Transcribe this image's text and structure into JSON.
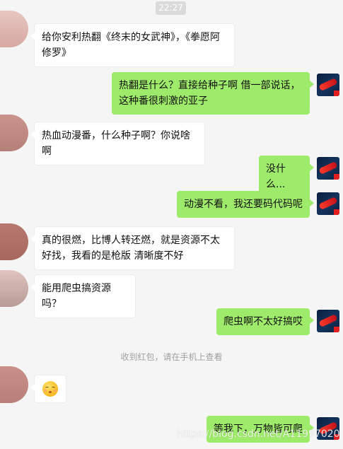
{
  "header": {
    "time": "22:27"
  },
  "colors": {
    "background": "#f5f5f5",
    "bubble_incoming": "#ffffff",
    "bubble_outgoing": "#9eea6a",
    "avatar_left_a": "#e8c3bd",
    "avatar_left_b": "#b07c74"
  },
  "messages": [
    {
      "side": "left",
      "text": "给你安利热翻《终末的女武神》，《拳愿阿修罗》"
    },
    {
      "side": "right",
      "text": "热翻是什么？直接给种子啊  借一部说话，这种番很刺激的亚子"
    },
    {
      "side": "left",
      "text": "热血动漫番，什么种子啊？你说啥啊"
    },
    {
      "side": "right",
      "text": "没什么..."
    },
    {
      "side": "right",
      "text": "动漫不看，我还要码代码呢"
    },
    {
      "side": "left",
      "text": "真的很燃，比博人转还燃，就是资源不太好找，我看的是枪版 清晰度不好"
    },
    {
      "side": "left",
      "text": "能用爬虫搞资源吗？"
    },
    {
      "side": "right",
      "text": "爬虫啊不太好搞哎"
    },
    {
      "side": "system",
      "text": "收到红包，请在手机上查看"
    },
    {
      "side": "left",
      "icon": "kissing-face-emoji"
    },
    {
      "side": "right",
      "text": "等我下，万物皆可爬"
    }
  ],
  "watermark": "https://blog.csdn.net/A11997020"
}
